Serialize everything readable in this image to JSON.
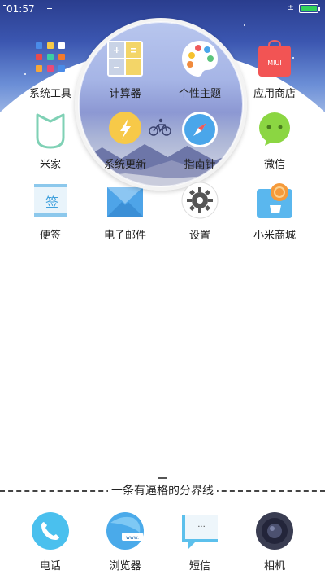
{
  "status_bar": {
    "time": "01:57",
    "net_indicator": "±",
    "battery_level": 1.0,
    "battery_color": "#32d35a"
  },
  "apps": [
    {
      "label": "系统工具",
      "icon": "folder-icon"
    },
    {
      "label": "计算器",
      "icon": "calculator-icon"
    },
    {
      "label": "个性主题",
      "icon": "palette-icon"
    },
    {
      "label": "应用商店",
      "icon": "app-store-icon"
    },
    {
      "label": "米家",
      "icon": "mijia-icon"
    },
    {
      "label": "系统更新",
      "icon": "system-update-icon"
    },
    {
      "label": "指南针",
      "icon": "compass-icon"
    },
    {
      "label": "微信",
      "icon": "wechat-icon"
    },
    {
      "label": "便签",
      "icon": "notes-icon"
    },
    {
      "label": "电子邮件",
      "icon": "email-icon"
    },
    {
      "label": "设置",
      "icon": "settings-icon"
    },
    {
      "label": "小米商城",
      "icon": "mi-store-icon"
    }
  ],
  "app_store_text": "MIUI",
  "notes_text": "签",
  "browser_text": "www.",
  "sms_text": "···",
  "divider": {
    "text": "一条有逼格的分界线"
  },
  "dock": [
    {
      "label": "电话",
      "icon": "phone-icon"
    },
    {
      "label": "浏览器",
      "icon": "browser-icon"
    },
    {
      "label": "短信",
      "icon": "sms-icon"
    },
    {
      "label": "相机",
      "icon": "camera-icon"
    }
  ]
}
